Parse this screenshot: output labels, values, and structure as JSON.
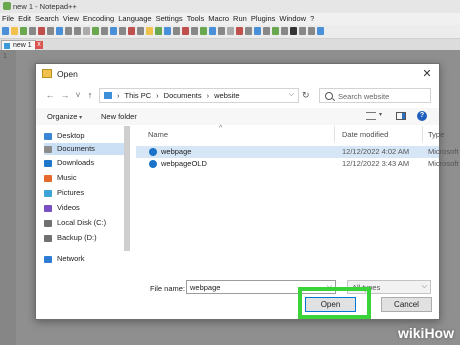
{
  "app": {
    "title": "new 1 - Notepad++",
    "menu": [
      "File",
      "Edit",
      "Search",
      "View",
      "Encoding",
      "Language",
      "Settings",
      "Tools",
      "Macro",
      "Run",
      "Plugins",
      "Window",
      "?"
    ],
    "tab_label": "new 1",
    "line_number": "1"
  },
  "dialog": {
    "title": "Open",
    "close": "✕",
    "nav": {
      "back": "←",
      "forward": "→",
      "recent": "˅",
      "up": "↑"
    },
    "breadcrumb": [
      "This PC",
      "Documents",
      "website"
    ],
    "refresh": "↻",
    "search_placeholder": "Search website",
    "organize": "Organize",
    "new_folder": "New folder",
    "help": "?",
    "sidebar": [
      {
        "label": "Desktop",
        "icon": "desktop-icon",
        "color": "#3a86d4"
      },
      {
        "label": "Documents",
        "icon": "documents-icon",
        "color": "#8c8c8c",
        "selected": true
      },
      {
        "label": "Downloads",
        "icon": "downloads-icon",
        "color": "#1f77c9"
      },
      {
        "label": "Music",
        "icon": "music-icon",
        "color": "#e36a2c"
      },
      {
        "label": "Pictures",
        "icon": "pictures-icon",
        "color": "#3ba3d6"
      },
      {
        "label": "Videos",
        "icon": "videos-icon",
        "color": "#7b4fc4"
      },
      {
        "label": "Local Disk (C:)",
        "icon": "drive-icon",
        "color": "#707070"
      },
      {
        "label": "Backup (D:)",
        "icon": "drive-icon",
        "color": "#707070"
      },
      {
        "label": "Network",
        "icon": "network-icon",
        "color": "#2d7dd2"
      }
    ],
    "columns": {
      "name": "Name",
      "date": "Date modified",
      "type": "Type",
      "sort_arrow": "^"
    },
    "files": [
      {
        "name": "webpage",
        "date": "12/12/2022 4:02 AM",
        "type": "Microsoft Ed",
        "selected": true
      },
      {
        "name": "webpageOLD",
        "date": "12/12/2022 3:43 AM",
        "type": "Microsoft Ed",
        "selected": false
      }
    ],
    "file_name_label": "File name:",
    "file_name_value": "webpage",
    "file_type_value": "All types",
    "open_button": "Open",
    "cancel_button": "Cancel"
  },
  "watermark": {
    "prefix": "wiki",
    "suffix": "How"
  },
  "colors": {
    "highlight": "#3ad43a",
    "accent": "#0078d7",
    "selection": "#d6e6f7"
  }
}
